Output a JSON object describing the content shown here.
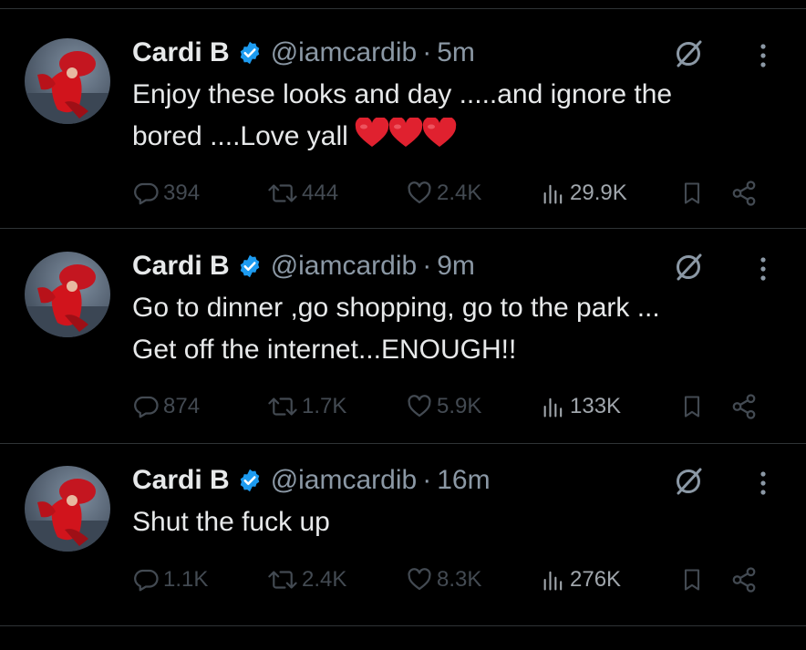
{
  "colors": {
    "background": "#000000",
    "text": "#e7e9ea",
    "secondary": "#8b98a5",
    "dimmed": "#434a52",
    "verified": "#1d9bf0",
    "heart": "#e0212f"
  },
  "icons": [
    "verified-badge-icon",
    "grok-icon",
    "more-icon",
    "reply-icon",
    "repost-icon",
    "like-icon",
    "views-icon",
    "bookmark-icon",
    "share-icon",
    "heart-emoji-icon"
  ],
  "tweets": [
    {
      "name": "Cardi B",
      "handle": "@iamcardib",
      "time": "5m",
      "text_line1": "Enjoy these looks and day .....and ignore the",
      "text_line2": "bored ....Love yall",
      "heart_emoji_count": 3,
      "replies": "394",
      "reposts": "444",
      "likes": "2.4K",
      "views": "29.9K"
    },
    {
      "name": "Cardi B",
      "handle": "@iamcardib",
      "time": "9m",
      "text_line1": "Go to dinner ,go shopping, go to the park ...",
      "text_line2": "Get off the internet...ENOUGH!!",
      "replies": "874",
      "reposts": "1.7K",
      "likes": "5.9K",
      "views": "133K"
    },
    {
      "name": "Cardi B",
      "handle": "@iamcardib",
      "time": "16m",
      "text_line1": "Shut the fuck up",
      "replies": "1.1K",
      "reposts": "2.4K",
      "likes": "8.3K",
      "views": "276K"
    }
  ]
}
